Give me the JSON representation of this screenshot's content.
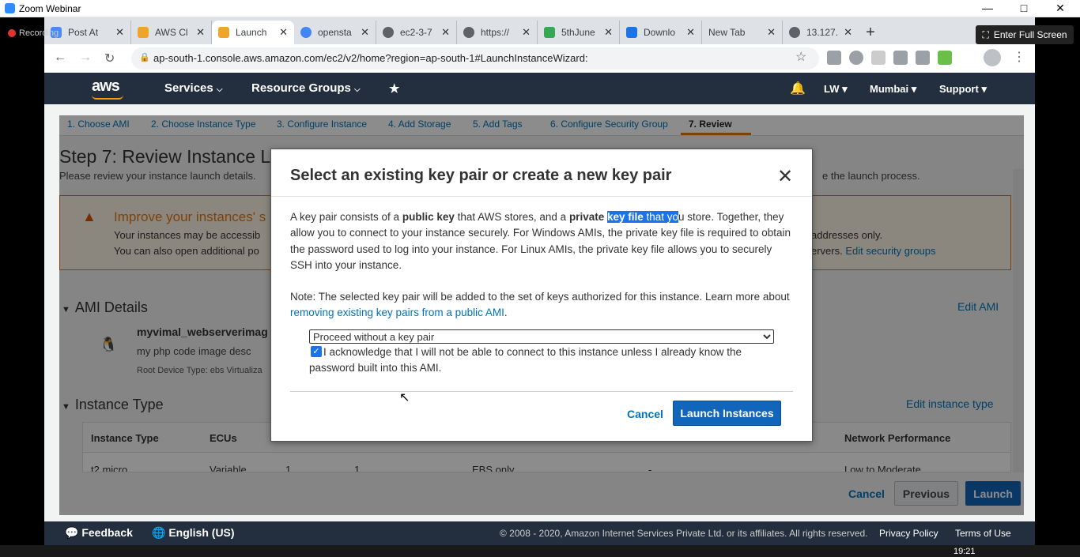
{
  "window": {
    "title": "Zoom Webinar",
    "recording": "Recording",
    "fullscreen": "Enter Full Screen"
  },
  "browser": {
    "tabs": [
      {
        "label": "Post At",
        "color": "#4a8af4"
      },
      {
        "label": "AWS Cl",
        "color": "#f0a52a"
      },
      {
        "label": "Launch",
        "color": "#f0a52a"
      },
      {
        "label": "opensta",
        "color": "#4285f4"
      },
      {
        "label": "ec2-3-7",
        "color": "#5f6368"
      },
      {
        "label": "https://",
        "color": "#5f6368"
      },
      {
        "label": "5thJune",
        "color": "#34a853"
      },
      {
        "label": "Downlo",
        "color": "#1a73e8"
      },
      {
        "label": "New Tab",
        "color": "#dee1e6"
      },
      {
        "label": "13.127.",
        "color": "#5f6368"
      }
    ],
    "url": "ap-south-1.console.aws.amazon.com/ec2/v2/home?region=ap-south-1#LaunchInstanceWizard:"
  },
  "aws_nav": {
    "logo": "aws",
    "services": "Services",
    "resource_groups": "Resource Groups",
    "account": "LW",
    "region": "Mumbai",
    "support": "Support"
  },
  "wizard": {
    "steps": [
      "1. Choose AMI",
      "2. Choose Instance Type",
      "3. Configure Instance",
      "4. Add Storage",
      "5. Add Tags",
      "6. Configure Security Group",
      "7. Review"
    ],
    "title": "Step 7: Review Instance L",
    "subtitle": "Please review your instance launch details.",
    "subtitle_right": "e the launch process.",
    "warning": {
      "title": "Improve your instances' s",
      "line1": "Your instances may be accessib",
      "line2": "You can also open additional po",
      "right1": "addresses only.",
      "right2_prefix": "ervers.",
      "right2_link": "Edit security groups"
    },
    "ami_section": "AMI Details",
    "edit_ami": "Edit AMI",
    "ami_name": "myvimal_webserverimag",
    "ami_desc": "my php code image desc",
    "ami_root": "Root Device Type: ebs    Virtualiza",
    "instance_section": "Instance Type",
    "edit_instance": "Edit instance type",
    "table": {
      "headers": [
        "Instance Type",
        "ECUs",
        "Network Performance"
      ],
      "row": [
        "t2.micro",
        "Variable",
        "1",
        "1",
        "EBS only",
        "-",
        "Low to Moderate"
      ]
    },
    "buttons": {
      "cancel": "Cancel",
      "previous": "Previous",
      "launch": "Launch"
    }
  },
  "modal": {
    "title": "Select an existing key pair or create a new key pair",
    "p1_a": "A key pair consists of a ",
    "p1_b": "public key",
    "p1_c": " that AWS stores, and a ",
    "p1_d": "private",
    "p1_e": " ",
    "p1_hl1": "key file",
    "p1_hl2": " that yo",
    "p1_f": "u store. Together, they allow you to connect to your instance securely. For Windows AMIs, the private key file is required to obtain the password used to log into your instance. For Linux AMIs, the private key file allows you to securely SSH into your instance.",
    "note_a": "Note: The selected key pair will be added to the set of keys authorized for this instance. Learn more about ",
    "note_link": "removing existing key pairs from a public AMI",
    "note_b": ".",
    "select_value": "Proceed without a key pair",
    "ack": "I acknowledge that I will not be able to connect to this instance unless I already know the password built into this AMI.",
    "cancel": "Cancel",
    "launch": "Launch Instances"
  },
  "footer": {
    "feedback": "Feedback",
    "language": "English (US)",
    "copyright": "© 2008 - 2020, Amazon Internet Services Private Ltd. or its affiliates. All rights reserved.",
    "privacy": "Privacy Policy",
    "terms": "Terms of Use"
  },
  "taskbar": {
    "time": "19:21"
  }
}
